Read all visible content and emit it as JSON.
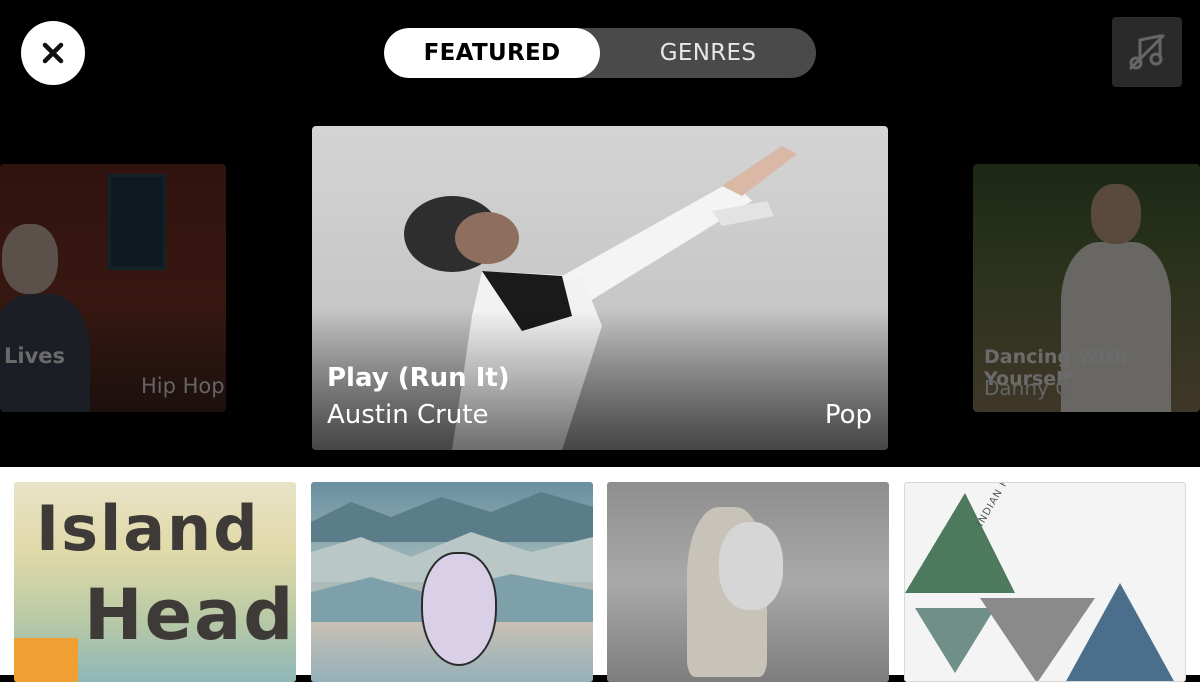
{
  "tabs": [
    {
      "label": "FEATURED",
      "active": true
    },
    {
      "label": "GENRES",
      "active": false
    }
  ],
  "icons": {
    "close": "close-icon",
    "music": "music-off-icon"
  },
  "carousel": {
    "left": {
      "title": "Lives",
      "genre": "Hip Hop"
    },
    "center": {
      "title": "Play (Run It)",
      "artist": "Austin Crute",
      "genre": "Pop"
    },
    "right": {
      "title": "Dancing With Yourself",
      "artist": "Danny G."
    }
  },
  "albums": [
    {
      "art_text_1": "Island",
      "art_text_2": "Head"
    },
    {},
    {},
    {
      "art_text": "INDIAN RUN"
    }
  ],
  "colors": {
    "background": "#000000",
    "segment_bg": "#4a4a4a",
    "active_tab": "#ffffff"
  }
}
